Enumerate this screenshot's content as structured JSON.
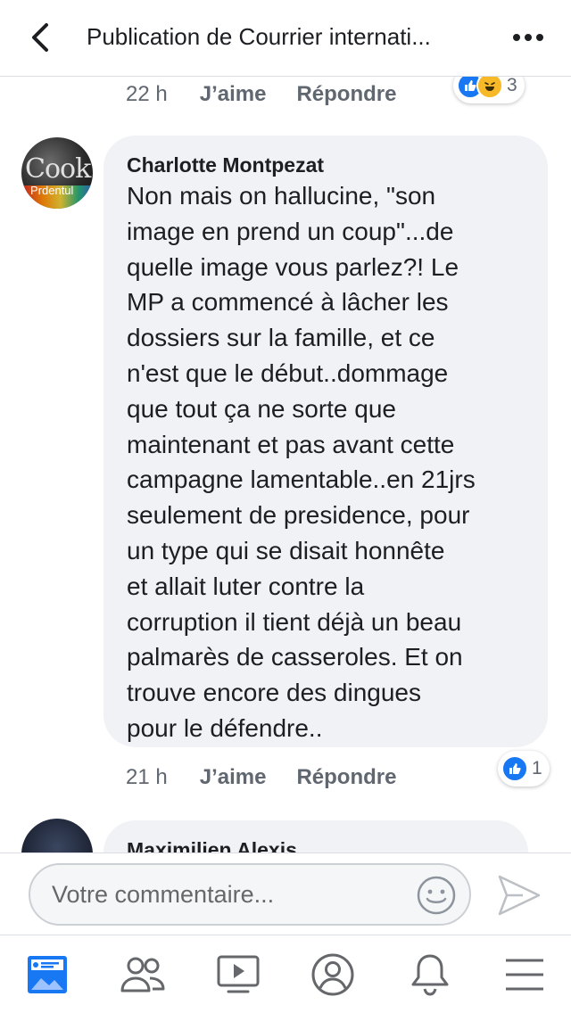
{
  "header": {
    "title": "Publication de Courrier internati..."
  },
  "previous_comment": {
    "time": "22 h",
    "like_label": "J’aime",
    "reply_label": "Répondre",
    "reaction_count": "3"
  },
  "comment": {
    "author": "Charlotte Montpezat",
    "avatar_text": "Cook",
    "avatar_subtext": "Prdentul",
    "lines": [
      "Non mais on hallucine, \"son",
      "image en prend un coup\"...de",
      "quelle image vous parlez?! Le",
      "MP a commencé à lâcher les",
      "dossiers sur la famille, et ce",
      "n'est que le début..dommage",
      "que tout ça ne sorte que",
      "maintenant et pas avant cette",
      "campagne lamentable..en 21jrs",
      "seulement de presidence, pour",
      "un type qui se disait honnête",
      "et allait luter contre la",
      "corruption il tient déjà un beau",
      "palmarès de casseroles. Et on",
      "trouve encore des dingues",
      "pour le défendre.."
    ],
    "time": "21 h",
    "like_label": "J’aime",
    "reply_label": "Répondre",
    "reaction_count": "1"
  },
  "next_comment": {
    "author": "Maximilien Alexis"
  },
  "composer": {
    "placeholder": "Votre commentaire..."
  },
  "tabs": [
    "news-feed-icon",
    "friends-icon",
    "watch-icon",
    "profile-icon",
    "notifications-icon",
    "menu-icon"
  ],
  "colors": {
    "accent": "#1877f2",
    "bubble": "#f0f2f5",
    "meta_text": "#606770"
  }
}
